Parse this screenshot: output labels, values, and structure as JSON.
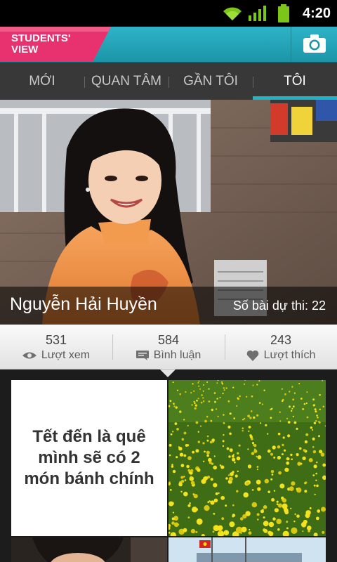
{
  "status_bar": {
    "time": "4:20"
  },
  "header": {
    "logo_line1": "STUDENTS'",
    "logo_line2": "VIEW"
  },
  "tabs": [
    {
      "label": "MỚI"
    },
    {
      "label": "QUAN TÂM"
    },
    {
      "label": "GẦN TÔI"
    },
    {
      "label": "TÔI",
      "active": true
    }
  ],
  "profile": {
    "name": "Nguyễn Hải Huyền",
    "entries_label": "Số bài dự thi: 22"
  },
  "stats": [
    {
      "value": "531",
      "label": "Lượt xem",
      "icon": "eye-icon"
    },
    {
      "value": "584",
      "label": "Bình luận",
      "icon": "comment-icon"
    },
    {
      "value": "243",
      "label": "Lượt thích",
      "icon": "heart-icon"
    }
  ],
  "posts": [
    {
      "type": "text",
      "text": "Tết đến là quê mình sẽ có 2 món bánh chính"
    },
    {
      "type": "photo",
      "subject": "yellow flower field"
    },
    {
      "type": "photo",
      "subject": "person"
    },
    {
      "type": "photo",
      "subject": "harbor with flag"
    }
  ],
  "colors": {
    "accent": "#1fb3c6",
    "logo_pink": "#e8316f",
    "tab_bar": "#383838"
  }
}
